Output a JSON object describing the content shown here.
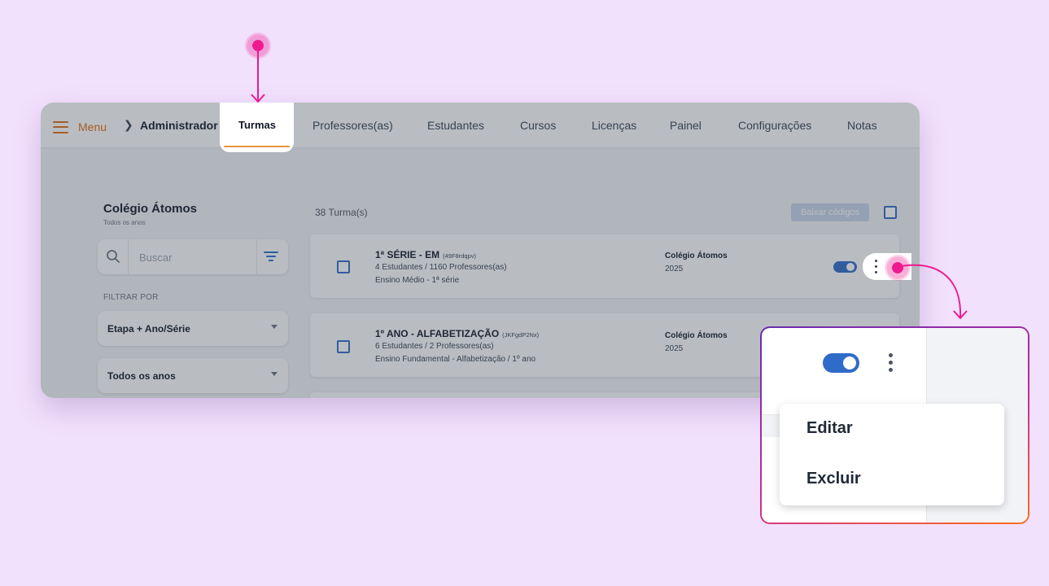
{
  "topbar": {
    "menu_label": "Menu",
    "breadcrumb_root": "Administrador",
    "tabs": [
      {
        "label": "Turmas",
        "active": true
      },
      {
        "label": "Professores(as)"
      },
      {
        "label": "Estudantes"
      },
      {
        "label": "Cursos"
      },
      {
        "label": "Licenças"
      },
      {
        "label": "Painel"
      },
      {
        "label": "Configurações"
      },
      {
        "label": "Notas"
      }
    ]
  },
  "sidebar": {
    "school_name": "Colégio Átomos",
    "school_sub": "Todos os anos",
    "search_placeholder": "Buscar",
    "filter_heading": "FILTRAR POR",
    "filters": [
      {
        "value": "Etapa + Ano/Série"
      },
      {
        "value": "Todos os anos"
      }
    ]
  },
  "list": {
    "count": "38 Turma(s)",
    "download_label": "Baixar códigos",
    "classes": [
      {
        "name": "1ª SÉRIE - EM",
        "code": "(49F8rdqpv)",
        "members": "4 Estudantes / 1160 Professores(as)",
        "level": "Ensino Médio - 1ª série",
        "school": "Colégio Átomos",
        "year": "2025",
        "active": true
      },
      {
        "name": "1º ANO - ALFABETIZAÇÃO",
        "code": "(JKFgdP2Nx)",
        "members": "6 Estudantes / 2 Professores(as)",
        "level": "Ensino Fundamental - Alfabetização / 1º ano",
        "school": "Colégio Átomos",
        "year": "2025",
        "active": true
      }
    ]
  },
  "popup_menu": {
    "items": [
      "Editar",
      "Excluir"
    ]
  },
  "colors": {
    "accent_orange": "#e46c12",
    "primary_blue": "#2f6bc8",
    "highlight_pink": "#ee1a8f",
    "background": "#f2e1fd"
  }
}
